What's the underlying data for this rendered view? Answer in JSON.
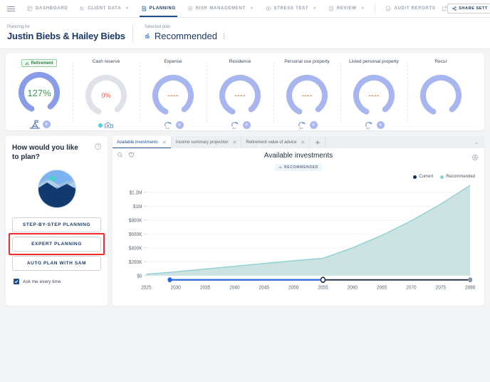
{
  "topnav": {
    "menu_icon": "hamburger-icon",
    "items": [
      {
        "label": "DASHBOARD",
        "icon": "dashboard-icon",
        "caret": false,
        "active": false
      },
      {
        "label": "CLIENT DATA",
        "icon": "people-icon",
        "caret": true,
        "active": false
      },
      {
        "label": "PLANNING",
        "icon": "planning-icon",
        "caret": false,
        "active": true
      },
      {
        "label": "RISK MANAGEMENT",
        "icon": "shield-icon",
        "caret": true,
        "active": false
      },
      {
        "label": "STRESS TEST",
        "icon": "target-icon",
        "caret": true,
        "active": false
      },
      {
        "label": "REVIEW",
        "icon": "review-icon",
        "caret": true,
        "active": false
      }
    ],
    "audit": {
      "label": "AUDIT REPORTS",
      "icon": "report-icon",
      "external_icon": "external-link-icon"
    },
    "share": {
      "label": "SHARE SETT",
      "icon": "share-icon"
    }
  },
  "header": {
    "planning_for_label": "Planning for",
    "client_names": "Justin Biebs & Hailey Biebs",
    "selected_plan_label": "Selected plan",
    "plan_name": "Recommended",
    "plan_icon": "plan-icon",
    "menu_icon": "kebab-menu-icon"
  },
  "kpis": [
    {
      "title": "Retirement",
      "badge": true,
      "badge_icon": "retirement-icon",
      "value": "127%",
      "value_state": "green",
      "ring_pct": 82,
      "ring_color": "#8a9ce8",
      "foot_icon": "flag-mountain-icon",
      "has_plus": true,
      "has_dot": false
    },
    {
      "title": "Cash reserve",
      "badge": false,
      "value": "0%",
      "value_state": "red",
      "ring_pct": 0,
      "ring_color": "#dfe2e8",
      "foot_icon": "cash-icon",
      "has_plus": false,
      "has_dot": true
    },
    {
      "title": "Expense",
      "badge": false,
      "value": "----",
      "value_state": "dash",
      "ring_pct": 82,
      "ring_color": "#a8b6ef",
      "foot_icon": "expense-icon",
      "has_plus": true,
      "has_dot": false
    },
    {
      "title": "Residence",
      "badge": false,
      "value": "----",
      "value_state": "dash",
      "ring_pct": 82,
      "ring_color": "#a8b6ef",
      "foot_icon": "residence-icon",
      "has_plus": true,
      "has_dot": false
    },
    {
      "title": "Personal use property",
      "badge": false,
      "value": "----",
      "value_state": "dash",
      "ring_pct": 82,
      "ring_color": "#a8b6ef",
      "foot_icon": "property-icon",
      "has_plus": true,
      "has_dot": false
    },
    {
      "title": "Listed personal property",
      "badge": false,
      "value": "----",
      "value_state": "dash",
      "ring_pct": 82,
      "ring_color": "#a8b6ef",
      "foot_icon": "listed-property-icon",
      "has_plus": true,
      "has_dot": false
    },
    {
      "title": "Recur",
      "badge": false,
      "value": "",
      "value_state": "dash",
      "ring_pct": 82,
      "ring_color": "#a8b6ef",
      "foot_icon": "recurring-icon",
      "has_plus": false,
      "has_dot": false
    }
  ],
  "left_panel": {
    "title": "How would you like to plan?",
    "help_icon": "help-icon",
    "illustration_icon": "mountain-lake-icon",
    "buttons": [
      {
        "label": "STEP-BY-STEP PLANNING",
        "highlighted": false
      },
      {
        "label": "EXPERT PLANNING",
        "highlighted": true
      },
      {
        "label": "AUTO PLAN WITH SAM",
        "highlighted": false
      }
    ],
    "checkbox_label": "Ask me every time",
    "checkbox_checked": true
  },
  "chart_panel": {
    "tabs": [
      {
        "label": "Available investments",
        "active": true,
        "close_icon": "close-icon"
      },
      {
        "label": "Income summary projection",
        "active": false,
        "close_icon": "close-icon"
      },
      {
        "label": "Retirement value of advice",
        "active": false,
        "close_icon": "close-icon"
      }
    ],
    "add_tab_icon": "plus-icon",
    "collapse_icon": "chevron-down-icon",
    "tools": [
      {
        "icon": "zoom-icon"
      },
      {
        "icon": "heart-icon"
      }
    ],
    "settings_icon": "settings-circle-icon",
    "badge_label": "RECOMMENDED",
    "badge_icon": "chart-bar-icon",
    "slider": {
      "min_year": 2029,
      "max_year": 2080,
      "handle_year": 2055
    }
  },
  "chart_data": {
    "type": "area",
    "title": "Available investments",
    "xlabel": "",
    "ylabel": "",
    "grid": true,
    "legend_position": "top-right",
    "legend": [
      {
        "name": "Current",
        "color": "#16314f"
      },
      {
        "name": "Recommended",
        "color": "#8ecfd4"
      }
    ],
    "ytick_labels": [
      "$0",
      "$200K",
      "$400K",
      "$600K",
      "$800K",
      "$1M",
      "$1.2M"
    ],
    "ytick_values": [
      0,
      200000,
      400000,
      600000,
      800000,
      1000000,
      1200000
    ],
    "ylim": [
      0,
      1300000
    ],
    "xtick_labels": [
      "2025",
      "2030",
      "2035",
      "2040",
      "2045",
      "2050",
      "2055",
      "2060",
      "2065",
      "2070",
      "2075",
      "2080"
    ],
    "xlim": [
      2025,
      2080
    ],
    "series": [
      {
        "name": "Recommended",
        "color": "#8ecfd4",
        "fill": "#c4dedd",
        "x": [
          2025,
          2030,
          2035,
          2040,
          2045,
          2050,
          2055,
          2060,
          2065,
          2070,
          2075,
          2080
        ],
        "values": [
          20000,
          55000,
          95000,
          135000,
          175000,
          215000,
          250000,
          400000,
          580000,
          790000,
          1030000,
          1300000
        ]
      }
    ]
  }
}
